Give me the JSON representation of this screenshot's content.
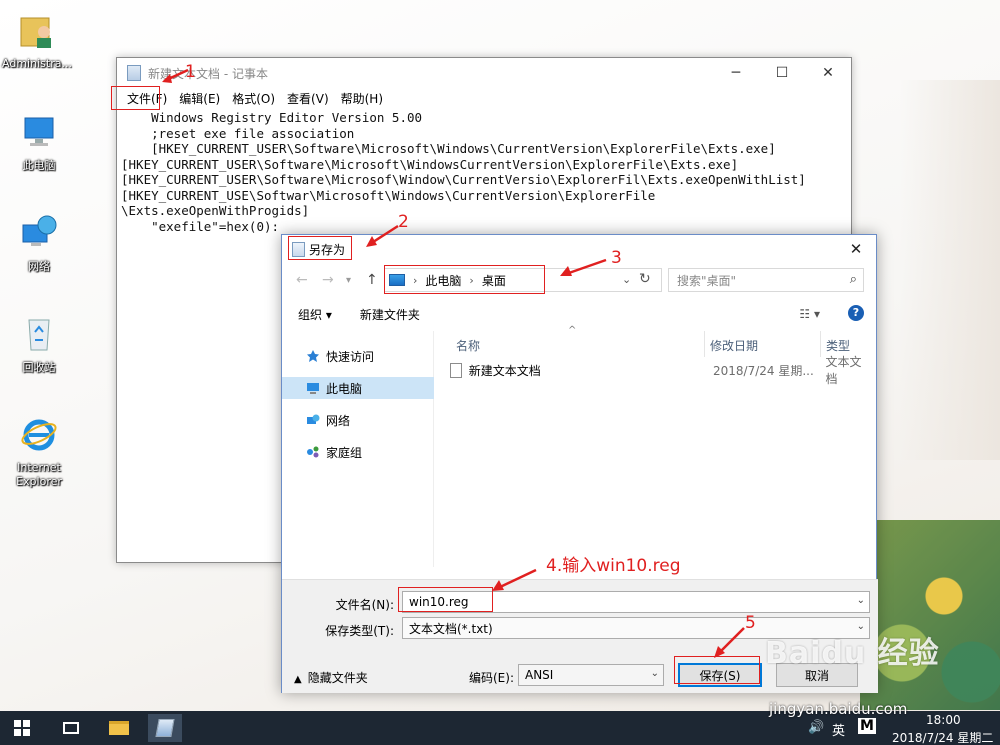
{
  "desktop": {
    "icons": [
      {
        "label": "Administra..."
      },
      {
        "label": "此电脑"
      },
      {
        "label": "网络"
      },
      {
        "label": "回收站"
      },
      {
        "label": "Internet Explorer"
      }
    ]
  },
  "notepad": {
    "title": "新建文本文档 - 记事本",
    "menu": [
      "文件(F)",
      "编辑(E)",
      "格式(O)",
      "查看(V)",
      "帮助(H)"
    ],
    "content": "    Windows Registry Editor Version 5.00\n    ;reset exe file association\n    [HKEY_CURRENT_USER\\Software\\Microsoft\\Windows\\CurrentVersion\\ExplorerFile\\Exts.exe]\n[HKEY_CURRENT_USER\\Software\\Microsoft\\WindowsCurrentVersion\\ExplorerFile\\Exts.exe]\n[HKEY_CURRENT_USER\\Software\\Microsof\\Window\\CurrentVersio\\ExplorerFil\\Exts.exeOpenWithList]\n[HKEY_CURRENT_USE\\Softwar\\Microsoft\\Windows\\CurrentVersion\\ExplorerFile\n\\Exts.exeOpenWithProgids]\n    \"exefile\"=hex(0):"
  },
  "dialog": {
    "title": "另存为",
    "breadcrumb": [
      "此电脑",
      "桌面"
    ],
    "search_placeholder": "搜索\"桌面\"",
    "toolbar": {
      "organize": "组织 ▾",
      "new_folder": "新建文件夹"
    },
    "nav_items": [
      "快速访问",
      "此电脑",
      "网络",
      "家庭组"
    ],
    "columns": [
      "名称",
      "修改日期",
      "类型"
    ],
    "files": [
      {
        "name": "新建文本文档",
        "modified": "2018/7/24 星期...",
        "type": "文本文档"
      }
    ],
    "filename_label": "文件名(N):",
    "filename_value": "win10.reg",
    "filetype_label": "保存类型(T):",
    "filetype_value": "文本文档(*.txt)",
    "hide_folders": "隐藏文件夹",
    "encoding_label": "编码(E):",
    "encoding_value": "ANSI",
    "save_button": "保存(S)",
    "cancel_button": "取消"
  },
  "annotations": {
    "n1": "1",
    "n2": "2",
    "n3": "3",
    "n4": "4.输入win10.reg",
    "n5": "5",
    "color": "#e02020"
  },
  "taskbar": {
    "language": "英",
    "ime": "M",
    "time": "18:00",
    "date": "2018/7/24 星期二"
  },
  "watermark": {
    "main": "Baidu 经验",
    "sub": "jingyan.baidu.com"
  }
}
